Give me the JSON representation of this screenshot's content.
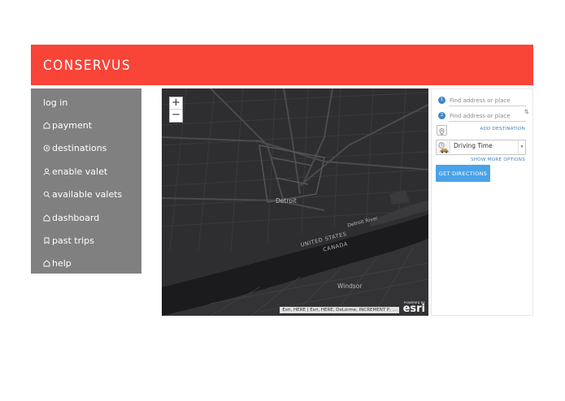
{
  "app": {
    "brand": "CONSERVUS",
    "accent_color": "#f94438"
  },
  "sidebar": {
    "items": [
      {
        "label": "log in",
        "icon": ""
      },
      {
        "label": "payment",
        "icon": "home-icon"
      },
      {
        "label": "destinations",
        "icon": "location-pin-icon"
      },
      {
        "label": "enable valet",
        "icon": "user-icon"
      },
      {
        "label": "available valets",
        "icon": "search-icon"
      },
      {
        "label": "dashboard",
        "icon": "home-icon"
      },
      {
        "label": "past trips",
        "icon": "bookmark-icon"
      },
      {
        "label": "help",
        "icon": "home-icon"
      }
    ]
  },
  "map": {
    "zoom_in": "+",
    "zoom_out": "−",
    "labels": {
      "city1": "Detroit",
      "river": "Detroit River",
      "country1": "UNITED STATES",
      "country2": "CANADA",
      "city2": "Windsor"
    },
    "attribution": "Esri, HERE | Esri, HERE, DeLorme, INCREMENT P, ...",
    "logo": {
      "powered_by": "POWERED BY",
      "wordmark": "esri"
    }
  },
  "directions": {
    "stops": [
      {
        "badge": "1",
        "placeholder": "Find address or place"
      },
      {
        "badge": "2",
        "placeholder": "Find address or place"
      }
    ],
    "reverse_icon": "swap-icon",
    "add_destination": "ADD DESTINATION",
    "travel_mode": "Driving Time",
    "show_more_options": "SHOW MORE OPTIONS",
    "get_directions": "GET DIRECTIONS",
    "button_color": "#4aa3e8",
    "link_color": "#3a7fc0"
  }
}
